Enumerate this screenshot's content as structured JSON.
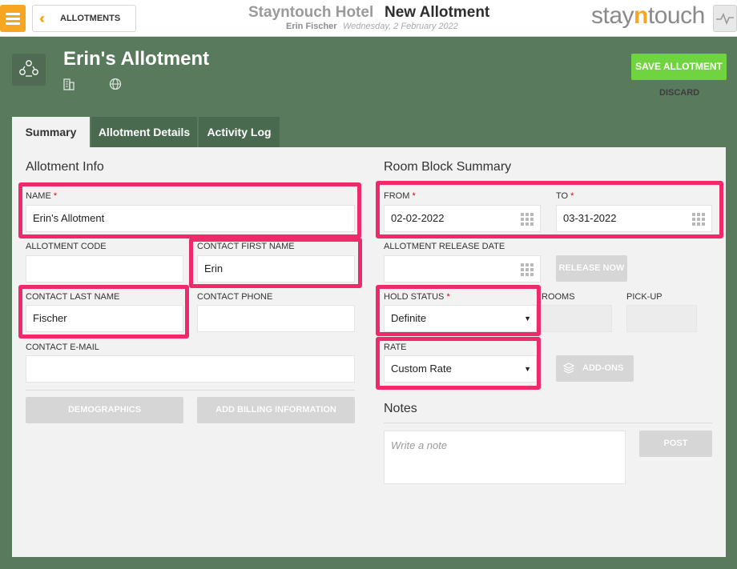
{
  "topbar": {
    "back_label": "ALLOTMENTS",
    "hotel_name": "Stayntouch Hotel",
    "page_title": "New Allotment",
    "user_name": "Erin Fischer",
    "business_date": "Wednesday, 2 February 2022",
    "logo_pre": "stay",
    "logo_n": "n",
    "logo_post": "touch"
  },
  "header": {
    "title": "Erin's Allotment",
    "save_label": "SAVE ALLOTMENT",
    "discard_label": "DISCARD"
  },
  "tabs": [
    {
      "label": "Summary"
    },
    {
      "label": "Allotment Details"
    },
    {
      "label": "Activity Log"
    }
  ],
  "allotment_info": {
    "title": "Allotment Info",
    "name_label": "NAME",
    "name_value": "Erin's Allotment",
    "code_label": "ALLOTMENT CODE",
    "code_value": "",
    "contact_first_label": "CONTACT FIRST NAME",
    "contact_first_value": "Erin",
    "contact_last_label": "CONTACT LAST NAME",
    "contact_last_value": "Fischer",
    "contact_phone_label": "CONTACT PHONE",
    "contact_phone_value": "",
    "contact_email_label": "CONTACT E-MAIL",
    "contact_email_value": "",
    "demographics_label": "DEMOGRAPHICS",
    "billing_label": "ADD BILLING INFORMATION"
  },
  "room_block": {
    "title": "Room Block Summary",
    "from_label": "FROM",
    "from_value": "02-02-2022",
    "to_label": "TO",
    "to_value": "03-31-2022",
    "release_date_label": "ALLOTMENT RELEASE DATE",
    "release_now_label": "RELEASE NOW",
    "hold_status_label": "HOLD STATUS",
    "hold_status_value": "Definite",
    "rooms_label": "ROOMS",
    "pickup_label": "PICK-UP",
    "rate_label": "RATE",
    "rate_value": "Custom Rate",
    "addons_label": "ADD-ONS"
  },
  "notes": {
    "title": "Notes",
    "placeholder": "Write a note",
    "post_label": "POST"
  },
  "colors": {
    "accent": "#f6a623",
    "save_green": "#6fd43f",
    "highlight": "#ee2a6a",
    "background": "#5a7a5e"
  },
  "icons": [
    "menu-icon",
    "double-chevron-left-icon",
    "activity-pulse-icon",
    "allotment-group-icon",
    "building-icon",
    "globe-icon",
    "calendar-grid-icon",
    "dropdown-caret-icon",
    "layers-icon"
  ]
}
